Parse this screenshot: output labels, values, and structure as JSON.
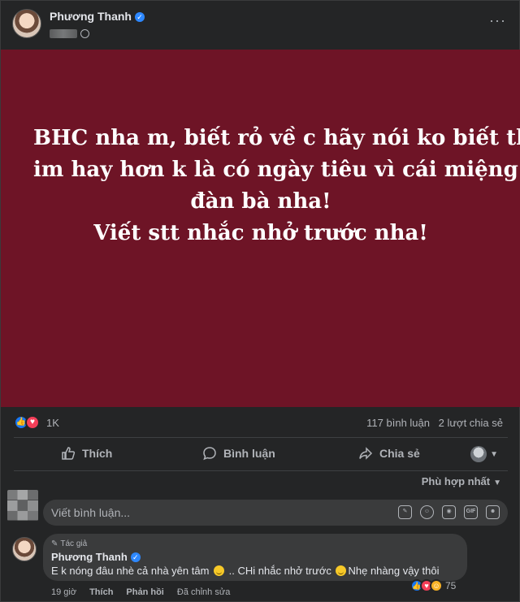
{
  "post": {
    "author": "Phương Thanh",
    "verified_mark": "✓",
    "more_icon": "···",
    "text_lines": [
      "BHC nha m, biết rỏ về c hãy nói ko biết thì",
      "im hay hơn k là có ngày tiêu vì cái miệng",
      "đàn bà nha!",
      "Viết stt nhắc nhở trước nha!"
    ],
    "background_color": "#6e1426"
  },
  "stats": {
    "reactions": "1K",
    "comments": "117 bình luận",
    "shares": "2 lượt chia sẻ"
  },
  "actions": {
    "like": "Thích",
    "comment": "Bình luận",
    "share": "Chia sẻ"
  },
  "sort": {
    "label": "Phù hợp nhất"
  },
  "composer": {
    "placeholder": "Viết bình luận...",
    "gif_label": "GIF"
  },
  "comment": {
    "badge": "Tác giả",
    "author": "Phương Thanh",
    "text_parts": [
      "E k nóng đâu nhè cả nhà yên tâm",
      ".. CHi nhắc nhở trước",
      "Nhẹ nhàng vậy thôi"
    ],
    "reaction_count": "75",
    "time": "19 giờ",
    "like_label": "Thích",
    "reply_label": "Phản hồi",
    "edited_label": "Đã chỉnh sửa"
  },
  "colors": {
    "background": "#242526",
    "post_background": "#6e1426",
    "accent": "#1877f2",
    "love": "#f33e58"
  },
  "icons": [
    "avatar",
    "verified-icon",
    "more-icon",
    "globe-icon",
    "like-reaction-icon",
    "love-reaction-icon",
    "haha-reaction-icon",
    "like-icon",
    "comment-icon",
    "share-icon",
    "chevron-down-icon",
    "sticker-icon",
    "emoji-icon",
    "camera-icon",
    "gif-icon",
    "pencil-icon"
  ]
}
